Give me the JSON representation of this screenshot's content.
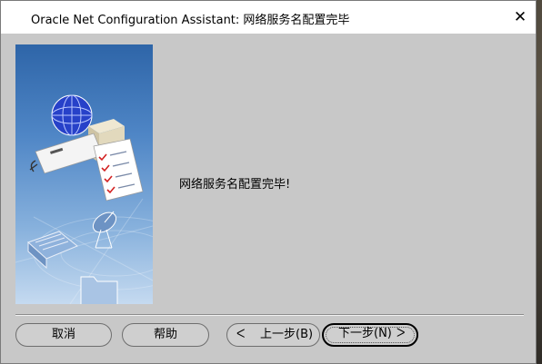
{
  "window": {
    "title": "Oracle Net Configuration Assistant: 网络服务名配置完毕",
    "close_glyph": "✕"
  },
  "main": {
    "message": "网络服务名配置完毕!"
  },
  "buttons": {
    "cancel": "取消",
    "help": "帮助",
    "back": "上一步(B)",
    "next": "下一步(N)",
    "back_arrow": "ᐸ",
    "next_arrow": "ᐳ"
  },
  "icons": {
    "app": "oracle-app-icon",
    "illustration": "network-configuration-illustration"
  }
}
